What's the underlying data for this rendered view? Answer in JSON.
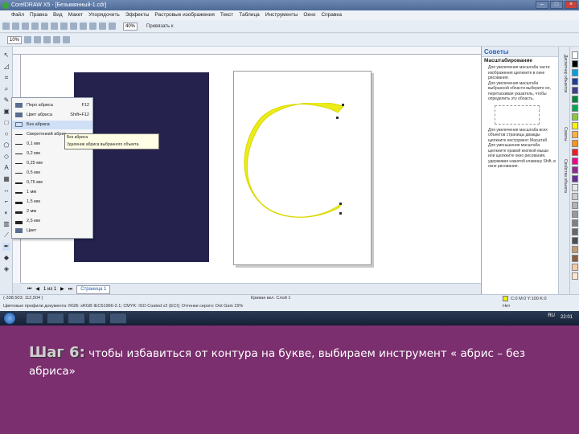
{
  "window": {
    "title": "CorelDRAW X5 - [Безымянный-1.cdr]",
    "controls": {
      "minimize": "–",
      "maximize": "□",
      "close": "×"
    }
  },
  "menu": [
    "Файл",
    "Правка",
    "Вид",
    "Макет",
    "Упорядочить",
    "Эффекты",
    "Растровые изображения",
    "Текст",
    "Таблица",
    "Инструменты",
    "Окно",
    "Справка"
  ],
  "toolbar": {
    "zoom": "40%",
    "snap_label": "Привязать к"
  },
  "propbar": {
    "zoom_value": "10%"
  },
  "outline_flyout": {
    "items": [
      {
        "label": "Перо абриса",
        "shortcut": "F12",
        "kind": "pen-icon"
      },
      {
        "label": "Цвет абриса",
        "shortcut": "Shift+F12",
        "kind": "color-icon"
      },
      {
        "label": "Без абриса",
        "shortcut": "",
        "kind": "no-outline-icon",
        "selected": true
      },
      {
        "label": "Сверхтонкий абрис",
        "shortcut": "",
        "kind": "hairline"
      },
      {
        "label": "0,1 мм",
        "shortcut": "",
        "kind": "line",
        "weight": 0.5
      },
      {
        "label": "0,2 мм",
        "shortcut": "",
        "kind": "line",
        "weight": 0.7
      },
      {
        "label": "0,25 мм",
        "shortcut": "",
        "kind": "line",
        "weight": 1
      },
      {
        "label": "0,5 мм",
        "shortcut": "",
        "kind": "line",
        "weight": 1.3
      },
      {
        "label": "0,75 мм",
        "shortcut": "",
        "kind": "line",
        "weight": 1.6
      },
      {
        "label": "1 мм",
        "shortcut": "",
        "kind": "line",
        "weight": 2
      },
      {
        "label": "1,5 мм",
        "shortcut": "",
        "kind": "line",
        "weight": 2.5
      },
      {
        "label": "2 мм",
        "shortcut": "",
        "kind": "line",
        "weight": 3
      },
      {
        "label": "2,5 мм",
        "shortcut": "",
        "kind": "line",
        "weight": 3.5
      },
      {
        "label": "Цвет",
        "shortcut": "",
        "kind": "color"
      }
    ],
    "tooltip_title": "Без абриса",
    "tooltip_text": "Удаление абриса выбранного объекта."
  },
  "page_nav": {
    "counter": "1 из 1",
    "tab": "Страница 1"
  },
  "status": {
    "coords": "(-338,503; 112,504 )",
    "middle": "Кривая вкл. Слой 1",
    "profiles": "Цветовые профили документа: RGB: sRGB IEC61966-2.1; CMYK: ISO Coated v2 (ECI); Оттенки серого: Dot Gain 15%",
    "fill_info": "C:0 M:0 Y:100 K:0",
    "outline_info": "Нет"
  },
  "docker": {
    "title": "Советы",
    "section": "Масштабирование",
    "paragraphs": [
      "Для увеличения масштаба части изображения щелкните в окне рисования.",
      "Для увеличения масштаба выбранной области выберите ее, перетаскивая указатель, чтобы определить эту область.",
      "Для увеличения масштаба всех объектов страницы дважды щелкните инструмент Масштаб.",
      "Для уменьшения масштаба щелкните правой кнопкой мыши или щелкните окно рисования, удерживая нажатой клавишу Shift, в окне рисования."
    ],
    "tabs": [
      "Диспетчер объектов",
      "Советы",
      "Свойства объекта"
    ]
  },
  "palette_colors": [
    "#ffffff",
    "#000000",
    "#00a0e0",
    "#1c3f94",
    "#3f3f8f",
    "#00843d",
    "#00a651",
    "#8dc63f",
    "#fff200",
    "#fbb040",
    "#f7941d",
    "#ed1c24",
    "#ec008c",
    "#92278f",
    "#662d91",
    "#e6e6e6",
    "#cccccc",
    "#b3b3b3",
    "#999999",
    "#808080",
    "#666666",
    "#4d4d4d",
    "#c49a6c",
    "#8b5e3c",
    "#f9c9a3",
    "#fde6cc"
  ],
  "taskbar": {
    "lang": "RU",
    "clock": "22:01"
  },
  "caption": {
    "step": "Шаг 6:",
    "text": " чтобы  избавиться от контура на букве, выбираем инструмент « абрис – без абриса»"
  }
}
